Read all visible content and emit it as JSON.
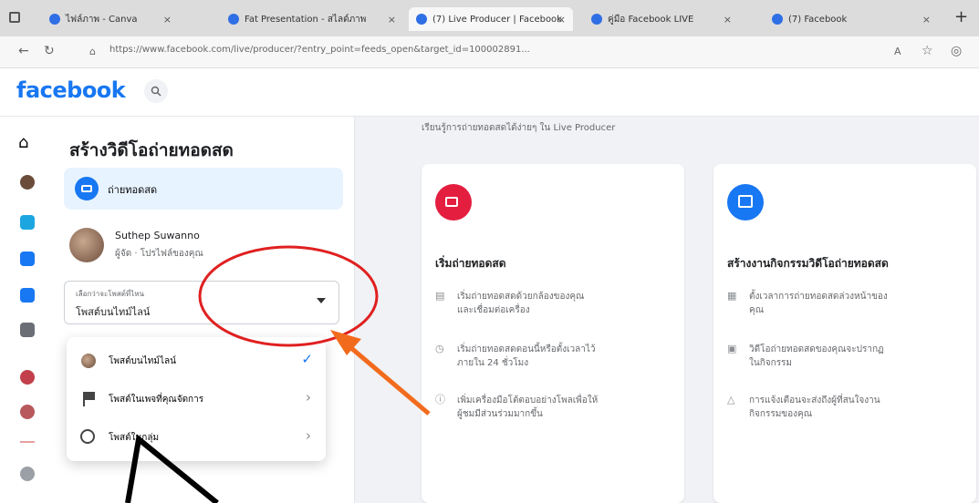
{
  "browser": {
    "tabs": [
      {
        "label": "ไฟล์ภาพ - Canva",
        "close": "×"
      },
      {
        "label": "Fat Presentation - สไลด์ภาพ",
        "close": "×"
      },
      {
        "label": "(7) Live Producer | Facebook",
        "close": "×"
      },
      {
        "label": "คู่มือ Facebook LIVE",
        "close": "×"
      },
      {
        "label": "(7) Facebook",
        "close": "×"
      }
    ],
    "new_tab": "+",
    "url": "https://www.facebook.com/live/producer/?entry_point=feeds_open&target_id=100002891..."
  },
  "facebook": {
    "logo": "facebook",
    "search_icon": "search-icon"
  },
  "panel": {
    "title": "สร้างวิดีโอถ่ายทอดสด",
    "mode_label": "ถ่ายทอดสด",
    "user_name": "Suthep Suwanno",
    "user_sub": "ผู้จัด · โปรไฟล์ของคุณ",
    "select_small": "เลือกว่าจะโพสต์ที่ไหน",
    "select_value": "โพสต์บนไทม์ไลน์",
    "menu": [
      {
        "label": "โพสต์บนไทม์ไลน์",
        "trail": "✓"
      },
      {
        "label": "โพสต์ในเพจที่คุณจัดการ",
        "trail": "›"
      },
      {
        "label": "โพสต์ในกลุ่ม",
        "trail": "›"
      }
    ]
  },
  "content": {
    "top_note": "เรียนรู้การถ่ายทอดสดได้ง่ายๆ ใน Live Producer",
    "cards": [
      {
        "title": "เริ่มถ่ายทอดสด",
        "bullets": [
          "เริ่มถ่ายทอดสดด้วยกล้องของคุณและเชื่อมต่อเครื่อง",
          "เริ่มถ่ายทอดสดตอนนี้หรือตั้งเวลาไว้ภายใน 24 ชั่วโมง",
          "เพิ่มเครื่องมือโต้ตอบอย่างโพลเพื่อให้ผู้ชมมีส่วนร่วมมากขึ้น"
        ]
      },
      {
        "title": "สร้างงานกิจกรรมวิดีโอถ่ายทอดสด",
        "bullets": [
          "ตั้งเวลาการถ่ายทอดสดล่วงหน้าของคุณ",
          "วิดีโอถ่ายทอดสดของคุณจะปรากฏในกิจกรรม",
          "การแจ้งเตือนจะส่งถึงผู้ที่สนใจงานกิจกรรมของคุณ"
        ]
      }
    ]
  },
  "colors": {
    "accent": "#1877f2",
    "live_red": "#e41e3f",
    "annotation_red": "#e02020",
    "annotation_orange": "#f26b1d"
  }
}
